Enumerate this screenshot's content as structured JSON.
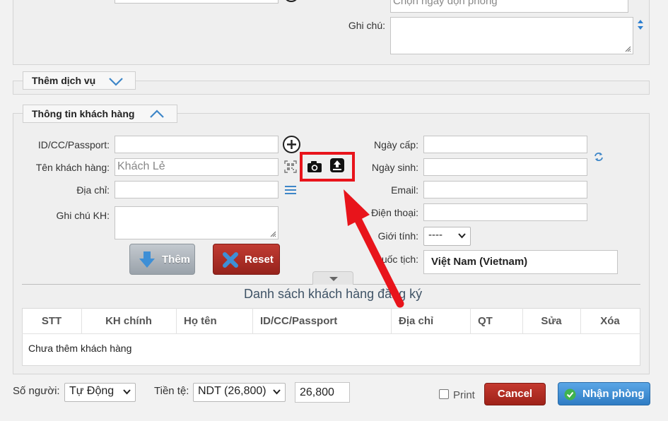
{
  "top_section": {
    "date_placeholder": "Chọn ngày dọn phòng",
    "note_label": "Ghi chú:"
  },
  "add_service": {
    "title": "Thêm dịch vụ"
  },
  "customer": {
    "title": "Thông tin khách hàng",
    "id_label": "ID/CC/Passport:",
    "name_label": "Tên khách hàng:",
    "name_placeholder": "Khách Lẻ",
    "address_label": "Địa chỉ:",
    "note_label": "Ghi chú KH:",
    "issue_date_label": "Ngày cấp:",
    "birth_date_label": "Ngày sinh:",
    "email_label": "Email:",
    "phone_label": "Điện thoại:",
    "gender_label": "Giới tính:",
    "gender_value": "----",
    "nationality_label": "Quốc tịch:",
    "nationality_value": "Việt Nam (Vietnam)",
    "add_button": "Thêm",
    "reset_button": "Reset"
  },
  "guest_list": {
    "title": "Danh sách khách hàng đăng ký",
    "columns": [
      "STT",
      "KH chính",
      "Họ tên",
      "ID/CC/Passport",
      "Địa chỉ",
      "QT",
      "Sửa",
      "Xóa"
    ],
    "empty_text": "Chưa thêm khách hàng"
  },
  "footer": {
    "people_label": "Số người:",
    "people_value": "Tự Động",
    "currency_label": "Tiền tệ:",
    "currency_value": "NDT (26,800)",
    "rate_value": "26,800",
    "print_label": "Print",
    "cancel_button": "Cancel",
    "checkin_button": "Nhận phòng"
  },
  "colors": {
    "highlight_box": "#e8141b",
    "arrow": "#e8141b",
    "cancel_bg": "#b92a22",
    "checkin_bg": "#3f8ed0",
    "reset_bg": "#b8322a",
    "add_bg": "#a9b1b9"
  },
  "icons": {
    "add_customer": "circle-plus-icon",
    "scan": "qr-scan-icon",
    "camera": "camera-icon",
    "upload": "upload-icon",
    "menu": "list-icon",
    "refresh": "refresh-icon",
    "resize": "vertical-resize-icon"
  }
}
